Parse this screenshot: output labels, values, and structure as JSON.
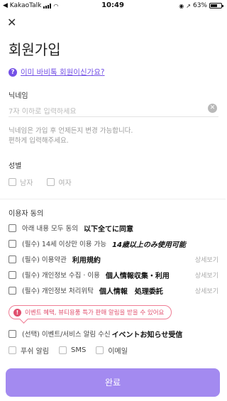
{
  "status_bar": {
    "carrier": "◀ KakaoTalk",
    "time": "10:49",
    "battery_text": "63%",
    "battery_level": 0.63
  },
  "header": {
    "title": "회원가입"
  },
  "member_link": {
    "icon": "?",
    "label": "이미 바비톡 회원이신가요?"
  },
  "nickname": {
    "label": "닉네임",
    "placeholder": "7자 이하로 입력하세요",
    "value": "",
    "helper_line1": "닉네임은 가입 후 언제든지 변경 가능합니다.",
    "helper_line2": "편하게 입력해주세요."
  },
  "gender": {
    "label": "성별",
    "options": [
      "남자",
      "여자"
    ]
  },
  "consent": {
    "label": "이용자 동의",
    "detail_label": "상세보기",
    "items": [
      {
        "label": "아래 내용 모두 동의",
        "note": "以下全てに同意",
        "detail": false
      },
      {
        "label": "(필수) 14세 이상만 이용 가능",
        "note": "14歳以上のみ使用可能",
        "detail": false
      },
      {
        "label": "(필수) 이용약관",
        "note": "利用規約",
        "detail": true
      },
      {
        "label": "(필수) 개인정보 수집 · 이용",
        "note": "個人情報収集・利用",
        "detail": true
      },
      {
        "label": "(필수) 개인정보 처리위탁",
        "note": "個人情報　処理委託",
        "detail": true
      }
    ],
    "notice": "이벤트 혜택, 뷰티용품 특가 판매 알림을 받을 수 있어요",
    "marketing": {
      "label": "(선택) 이벤트/서비스 알림 수신",
      "note": "イベントお知らせ受信"
    },
    "channels": [
      "푸쉬 알림",
      "SMS",
      "이메일"
    ]
  },
  "submit": {
    "label": "완료"
  },
  "colors": {
    "accent": "#7451e6",
    "button": "#a38af0",
    "notice": "#e0506e"
  }
}
